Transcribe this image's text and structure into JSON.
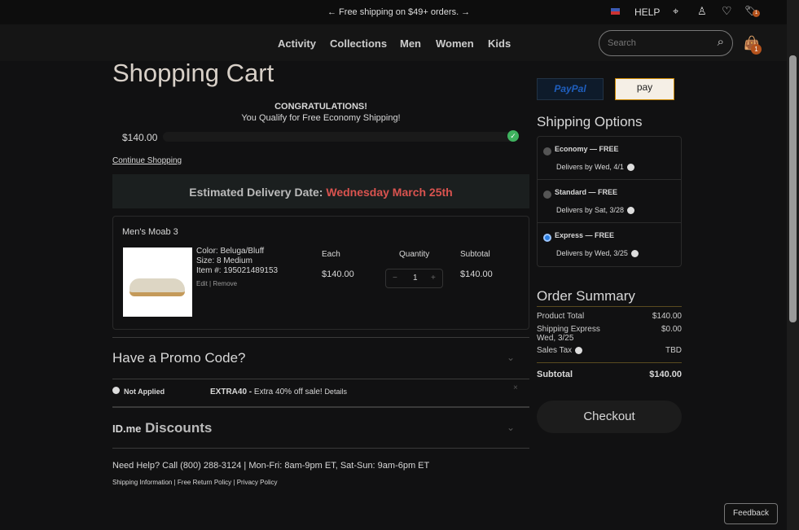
{
  "topbar": {
    "promo": "← Free shipping on $49+ orders. →",
    "help": "HELP",
    "cart_badge": "1"
  },
  "nav": {
    "links": [
      "Activity",
      "Collections",
      "Men",
      "Women",
      "Kids"
    ],
    "search_placeholder": "Search",
    "bag_badge": "1"
  },
  "cart": {
    "title": "Shopping Cart",
    "congrats": "CONGRATULATIONS!",
    "qualify": "You Qualify for Free Economy Shipping!",
    "progress_amount": "$140.00",
    "progress_percent": 100,
    "continue": "Continue Shopping",
    "delivery_label": "Estimated Delivery Date:",
    "delivery_date": "Wednesday March 25th",
    "item": {
      "name": "Men's Moab 3",
      "color": "Color: Beluga/Bluff",
      "size": "Size: 8 Medium",
      "item_no": "Item #: 195021489153",
      "edit": "Edit",
      "remove": "Remove",
      "each_label": "Each",
      "each": "$140.00",
      "qty_label": "Quantity",
      "qty": "1",
      "subtotal_label": "Subtotal",
      "subtotal": "$140.00"
    },
    "promo_title": "Have a Promo Code?",
    "promo_status": "Not Applied",
    "promo_code": "EXTRA40 -",
    "promo_desc": "Extra 40% off sale!",
    "promo_details": "Details",
    "idme": "ID.me",
    "discounts": "Discounts",
    "help": "Need Help? Call (800) 288-3124 | Mon-Fri: 8am-9pm ET, Sat-Sun: 9am-6pm ET",
    "links": [
      "Shipping Information",
      "Free Return Policy",
      "Privacy Policy"
    ]
  },
  "side": {
    "paypal": "PayPal",
    "amazon": "pay",
    "shipping_title": "Shipping Options",
    "options": [
      {
        "name": "Economy — FREE",
        "date": "Delivers by Wed, 4/1",
        "selected": false
      },
      {
        "name": "Standard — FREE",
        "date": "Delivers by Sat, 3/28",
        "selected": false
      },
      {
        "name": "Express — FREE",
        "date": "Delivers by Wed, 3/25",
        "selected": true
      }
    ],
    "summary_title": "Order Summary",
    "product_total_label": "Product Total",
    "product_total": "$140.00",
    "shipping_label": "Shipping Express",
    "shipping_date": "Wed, 3/25",
    "shipping": "$0.00",
    "tax_label": "Sales Tax",
    "tax": "TBD",
    "subtotal_label": "Subtotal",
    "subtotal": "$140.00",
    "checkout": "Checkout"
  },
  "feedback": "Feedback",
  "colors": {
    "accent": "#d9534f",
    "badge": "#b4521c",
    "check": "#3fb35f"
  }
}
